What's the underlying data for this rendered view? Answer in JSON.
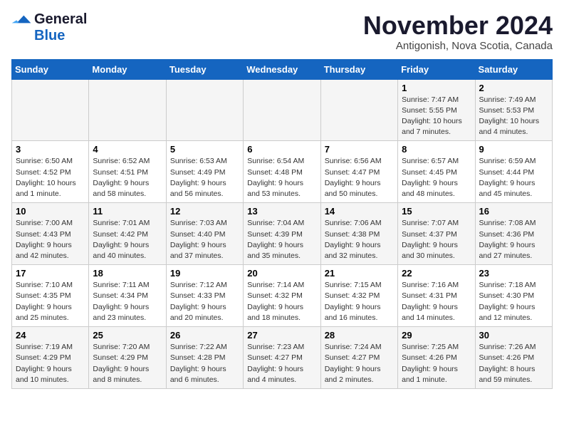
{
  "header": {
    "logo_line1": "General",
    "logo_line2": "Blue",
    "month": "November 2024",
    "location": "Antigonish, Nova Scotia, Canada"
  },
  "days_of_week": [
    "Sunday",
    "Monday",
    "Tuesday",
    "Wednesday",
    "Thursday",
    "Friday",
    "Saturday"
  ],
  "weeks": [
    [
      {
        "day": "",
        "info": ""
      },
      {
        "day": "",
        "info": ""
      },
      {
        "day": "",
        "info": ""
      },
      {
        "day": "",
        "info": ""
      },
      {
        "day": "",
        "info": ""
      },
      {
        "day": "1",
        "info": "Sunrise: 7:47 AM\nSunset: 5:55 PM\nDaylight: 10 hours and 7 minutes."
      },
      {
        "day": "2",
        "info": "Sunrise: 7:49 AM\nSunset: 5:53 PM\nDaylight: 10 hours and 4 minutes."
      }
    ],
    [
      {
        "day": "3",
        "info": "Sunrise: 6:50 AM\nSunset: 4:52 PM\nDaylight: 10 hours and 1 minute."
      },
      {
        "day": "4",
        "info": "Sunrise: 6:52 AM\nSunset: 4:51 PM\nDaylight: 9 hours and 58 minutes."
      },
      {
        "day": "5",
        "info": "Sunrise: 6:53 AM\nSunset: 4:49 PM\nDaylight: 9 hours and 56 minutes."
      },
      {
        "day": "6",
        "info": "Sunrise: 6:54 AM\nSunset: 4:48 PM\nDaylight: 9 hours and 53 minutes."
      },
      {
        "day": "7",
        "info": "Sunrise: 6:56 AM\nSunset: 4:47 PM\nDaylight: 9 hours and 50 minutes."
      },
      {
        "day": "8",
        "info": "Sunrise: 6:57 AM\nSunset: 4:45 PM\nDaylight: 9 hours and 48 minutes."
      },
      {
        "day": "9",
        "info": "Sunrise: 6:59 AM\nSunset: 4:44 PM\nDaylight: 9 hours and 45 minutes."
      }
    ],
    [
      {
        "day": "10",
        "info": "Sunrise: 7:00 AM\nSunset: 4:43 PM\nDaylight: 9 hours and 42 minutes."
      },
      {
        "day": "11",
        "info": "Sunrise: 7:01 AM\nSunset: 4:42 PM\nDaylight: 9 hours and 40 minutes."
      },
      {
        "day": "12",
        "info": "Sunrise: 7:03 AM\nSunset: 4:40 PM\nDaylight: 9 hours and 37 minutes."
      },
      {
        "day": "13",
        "info": "Sunrise: 7:04 AM\nSunset: 4:39 PM\nDaylight: 9 hours and 35 minutes."
      },
      {
        "day": "14",
        "info": "Sunrise: 7:06 AM\nSunset: 4:38 PM\nDaylight: 9 hours and 32 minutes."
      },
      {
        "day": "15",
        "info": "Sunrise: 7:07 AM\nSunset: 4:37 PM\nDaylight: 9 hours and 30 minutes."
      },
      {
        "day": "16",
        "info": "Sunrise: 7:08 AM\nSunset: 4:36 PM\nDaylight: 9 hours and 27 minutes."
      }
    ],
    [
      {
        "day": "17",
        "info": "Sunrise: 7:10 AM\nSunset: 4:35 PM\nDaylight: 9 hours and 25 minutes."
      },
      {
        "day": "18",
        "info": "Sunrise: 7:11 AM\nSunset: 4:34 PM\nDaylight: 9 hours and 23 minutes."
      },
      {
        "day": "19",
        "info": "Sunrise: 7:12 AM\nSunset: 4:33 PM\nDaylight: 9 hours and 20 minutes."
      },
      {
        "day": "20",
        "info": "Sunrise: 7:14 AM\nSunset: 4:32 PM\nDaylight: 9 hours and 18 minutes."
      },
      {
        "day": "21",
        "info": "Sunrise: 7:15 AM\nSunset: 4:32 PM\nDaylight: 9 hours and 16 minutes."
      },
      {
        "day": "22",
        "info": "Sunrise: 7:16 AM\nSunset: 4:31 PM\nDaylight: 9 hours and 14 minutes."
      },
      {
        "day": "23",
        "info": "Sunrise: 7:18 AM\nSunset: 4:30 PM\nDaylight: 9 hours and 12 minutes."
      }
    ],
    [
      {
        "day": "24",
        "info": "Sunrise: 7:19 AM\nSunset: 4:29 PM\nDaylight: 9 hours and 10 minutes."
      },
      {
        "day": "25",
        "info": "Sunrise: 7:20 AM\nSunset: 4:29 PM\nDaylight: 9 hours and 8 minutes."
      },
      {
        "day": "26",
        "info": "Sunrise: 7:22 AM\nSunset: 4:28 PM\nDaylight: 9 hours and 6 minutes."
      },
      {
        "day": "27",
        "info": "Sunrise: 7:23 AM\nSunset: 4:27 PM\nDaylight: 9 hours and 4 minutes."
      },
      {
        "day": "28",
        "info": "Sunrise: 7:24 AM\nSunset: 4:27 PM\nDaylight: 9 hours and 2 minutes."
      },
      {
        "day": "29",
        "info": "Sunrise: 7:25 AM\nSunset: 4:26 PM\nDaylight: 9 hours and 1 minute."
      },
      {
        "day": "30",
        "info": "Sunrise: 7:26 AM\nSunset: 4:26 PM\nDaylight: 8 hours and 59 minutes."
      }
    ]
  ]
}
